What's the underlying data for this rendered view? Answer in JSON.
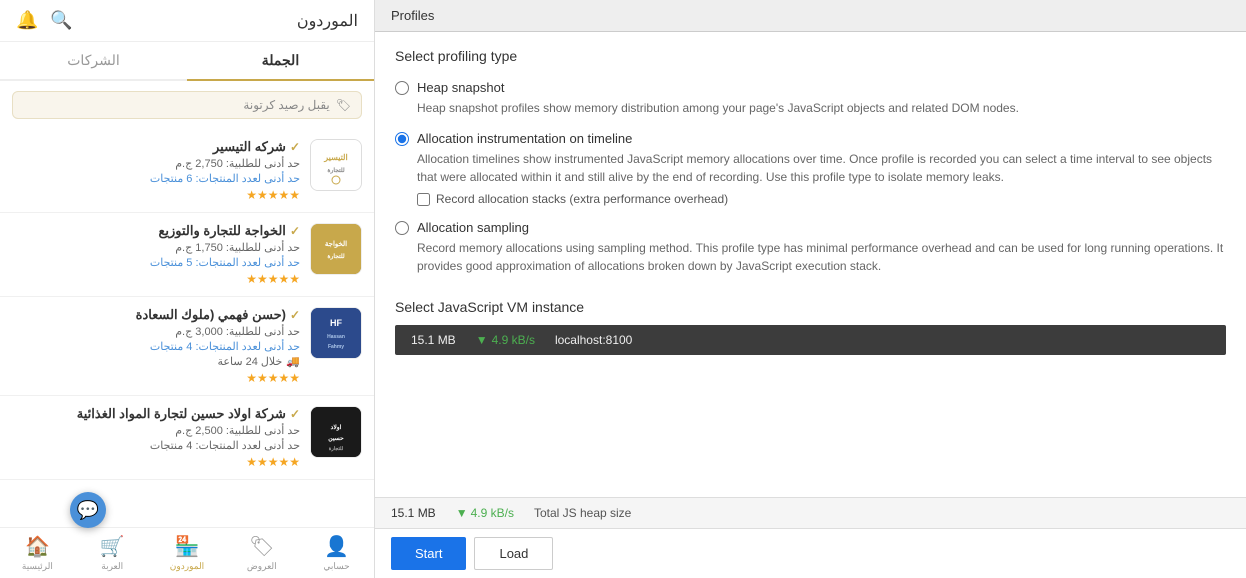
{
  "mobile": {
    "header_title": "الموردون",
    "tab_wholesale": "الجملة",
    "tab_companies": "الشركات",
    "search_placeholder": "يقبل رصيد كرتونة",
    "vendors": [
      {
        "name": "شركه التيسير",
        "verified": true,
        "min_order": "حد أدنى للطلبية: 2,750 ج.م",
        "min_products": "حد أدنى لعدد المنتجات: 6 منتجات",
        "stars": "★★★★★",
        "logo_type": "tayseer"
      },
      {
        "name": "الخواجة للتجارة والتوزيع",
        "verified": true,
        "min_order": "حد أدنى للطلبية: 1,750 ج.م",
        "min_products": "حد أدنى لعدد المنتجات: 5 منتجات",
        "stars": "★★★★★",
        "logo_type": "khawaja"
      },
      {
        "name": "(حسن فهمي (ملوك السعادة",
        "verified": true,
        "min_order": "حد أدنى للطلبية: 3,000 ج.م",
        "min_products": "حد أدنى لعدد المنتجات: 4 منتجات",
        "delivery": "خلال 24 ساعة",
        "stars": "★★★★★",
        "logo_type": "hassan"
      },
      {
        "name": "شركة اولاد حسين لتجارة المواد الغذائية",
        "verified": true,
        "min_order": "حد أدنى للطلبية: 2,500 ج.م",
        "min_products": "حد أدنى لعدد المنتجات: 4 منتجات",
        "stars": "★★★★★",
        "logo_type": "awlad"
      }
    ],
    "bottom_nav": [
      {
        "label": "الرئيسية",
        "icon": "🏠",
        "active": false
      },
      {
        "label": "العربة",
        "icon": "🛒",
        "active": false
      },
      {
        "label": "الموردون",
        "icon": "🏪",
        "active": true
      },
      {
        "label": "العروض",
        "icon": "🏷",
        "active": false
      },
      {
        "label": "حسابي",
        "icon": "👤",
        "active": false
      }
    ]
  },
  "devtools": {
    "tab_label": "Profiles",
    "section_title": "Select profiling type",
    "options": [
      {
        "id": "heap-snapshot",
        "label": "Heap snapshot",
        "description": "Heap snapshot profiles show memory distribution among your page's JavaScript objects and related DOM nodes.",
        "selected": false
      },
      {
        "id": "allocation-instrumentation",
        "label": "Allocation instrumentation on timeline",
        "description": "Allocation timelines show instrumented JavaScript memory allocations over time. Once profile is recorded you can select a time interval to see objects that were allocated within it and still alive by the end of recording. Use this profile type to isolate memory leaks.",
        "selected": true,
        "checkbox_label": "Record allocation stacks (extra performance overhead)"
      },
      {
        "id": "allocation-sampling",
        "label": "Allocation sampling",
        "description": "Record memory allocations using sampling method. This profile type has minimal performance overhead and can be used for long running operations. It provides good approximation of allocations broken down by JavaScript execution stack.",
        "selected": false
      }
    ],
    "vm_section_title": "Select JavaScript VM instance",
    "vm_instance": {
      "size": "15.1 MB",
      "speed": "4.9 kB/s",
      "url": "localhost:8100"
    },
    "bottom_stats": {
      "size": "15.1 MB",
      "speed": "4.9 kB/s",
      "label": "Total JS heap size"
    },
    "btn_start": "Start",
    "btn_load": "Load"
  }
}
